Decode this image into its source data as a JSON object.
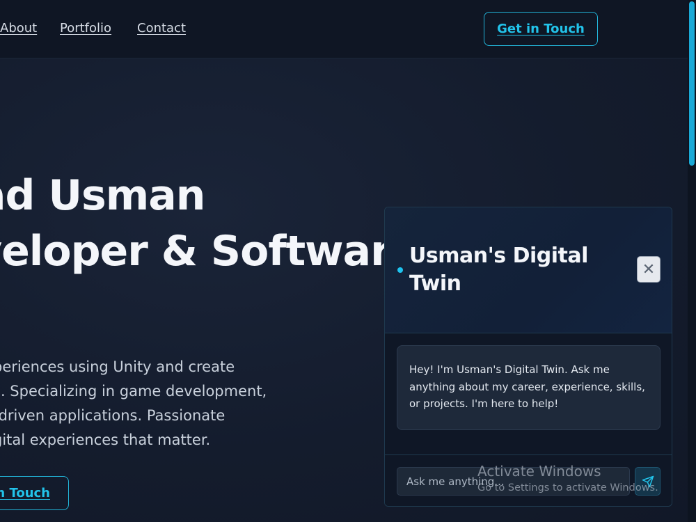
{
  "nav": {
    "links": [
      "About",
      "Portfolio",
      "Contact"
    ],
    "cta": "Get in Touch"
  },
  "hero": {
    "title_line1": "ad Usman",
    "title_line2": "veloper & Software",
    "description_lines": [
      "periences using Unity and create",
      "s. Specializing in game development,",
      "-driven applications. Passionate",
      "gital experiences that matter."
    ],
    "cta": "in Touch"
  },
  "chat": {
    "title": "Usman's Digital Twin",
    "close_symbol": "✕",
    "greeting": "Hey! I'm Usman's Digital Twin. Ask me anything about my career, experience, skills, or projects. I'm here to help!",
    "input_placeholder": "Ask me anything..."
  },
  "watermark": {
    "title": "Activate Windows",
    "subtitle": "Go to Settings to activate Windows."
  },
  "colors": {
    "accent": "#22c3ea",
    "background": "#131b2c",
    "panel": "#0f1726"
  },
  "icons": [
    "close-icon",
    "send-icon",
    "status-dot"
  ]
}
